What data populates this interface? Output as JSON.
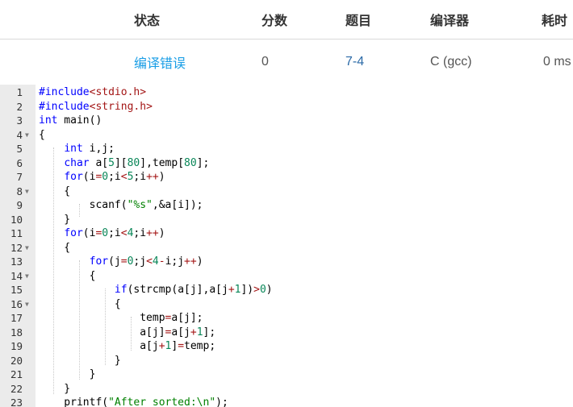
{
  "table": {
    "headers": [
      "状态",
      "分数",
      "题目",
      "编译器",
      "耗时"
    ],
    "row": {
      "status": "编译错误",
      "score": "0",
      "problem": "7-4",
      "compiler": "C (gcc)",
      "time": "0 ms"
    }
  },
  "editor": {
    "lines": [
      {
        "n": "1",
        "fold": false,
        "t": [
          [
            "#include",
            "kw"
          ],
          [
            "<stdio.h>",
            "inc"
          ]
        ]
      },
      {
        "n": "2",
        "fold": false,
        "t": [
          [
            "#include",
            "kw"
          ],
          [
            "<string.h>",
            "inc"
          ]
        ]
      },
      {
        "n": "3",
        "fold": false,
        "t": [
          [
            "int",
            "kw"
          ],
          [
            " main()",
            ""
          ]
        ]
      },
      {
        "n": "4",
        "fold": true,
        "t": [
          [
            "{",
            ""
          ]
        ]
      },
      {
        "n": "5",
        "fold": false,
        "t": [
          [
            "    ",
            ""
          ],
          [
            "int",
            "kw"
          ],
          [
            " i,j;",
            ""
          ]
        ]
      },
      {
        "n": "6",
        "fold": false,
        "t": [
          [
            "    ",
            ""
          ],
          [
            "char",
            "kw"
          ],
          [
            " a[",
            ""
          ],
          [
            "5",
            "num"
          ],
          [
            "][",
            ""
          ],
          [
            "80",
            "num"
          ],
          [
            "],temp[",
            ""
          ],
          [
            "80",
            "num"
          ],
          [
            "];",
            ""
          ]
        ]
      },
      {
        "n": "7",
        "fold": false,
        "t": [
          [
            "    ",
            ""
          ],
          [
            "for",
            "kw"
          ],
          [
            "(i",
            ""
          ],
          [
            "=",
            "op"
          ],
          [
            "0",
            "num"
          ],
          [
            ";i",
            ""
          ],
          [
            "<",
            "op"
          ],
          [
            "5",
            "num"
          ],
          [
            ";i",
            ""
          ],
          [
            "++",
            "op"
          ],
          [
            ")",
            ""
          ]
        ]
      },
      {
        "n": "8",
        "fold": true,
        "t": [
          [
            "    {",
            ""
          ]
        ]
      },
      {
        "n": "9",
        "fold": false,
        "t": [
          [
            "        scanf(",
            ""
          ],
          [
            "\"%s\"",
            "str"
          ],
          [
            ",&a[i]);",
            ""
          ]
        ]
      },
      {
        "n": "10",
        "fold": false,
        "t": [
          [
            "    }",
            ""
          ]
        ]
      },
      {
        "n": "11",
        "fold": false,
        "t": [
          [
            "    ",
            ""
          ],
          [
            "for",
            "kw"
          ],
          [
            "(i",
            ""
          ],
          [
            "=",
            "op"
          ],
          [
            "0",
            "num"
          ],
          [
            ";i",
            ""
          ],
          [
            "<",
            "op"
          ],
          [
            "4",
            "num"
          ],
          [
            ";i",
            ""
          ],
          [
            "++",
            "op"
          ],
          [
            ")",
            ""
          ]
        ]
      },
      {
        "n": "12",
        "fold": true,
        "t": [
          [
            "    {",
            ""
          ]
        ]
      },
      {
        "n": "13",
        "fold": false,
        "t": [
          [
            "        ",
            ""
          ],
          [
            "for",
            "kw"
          ],
          [
            "(j",
            ""
          ],
          [
            "=",
            "op"
          ],
          [
            "0",
            "num"
          ],
          [
            ";j",
            ""
          ],
          [
            "<",
            "op"
          ],
          [
            "4",
            "num"
          ],
          [
            "-",
            "op"
          ],
          [
            "i;j",
            ""
          ],
          [
            "++",
            "op"
          ],
          [
            ")",
            ""
          ]
        ]
      },
      {
        "n": "14",
        "fold": true,
        "t": [
          [
            "        {",
            ""
          ]
        ]
      },
      {
        "n": "15",
        "fold": false,
        "t": [
          [
            "            ",
            ""
          ],
          [
            "if",
            "kw"
          ],
          [
            "(strcmp(a[j],a[j",
            ""
          ],
          [
            "+",
            "op"
          ],
          [
            "1",
            "num"
          ],
          [
            "])",
            ""
          ],
          [
            ">",
            "op"
          ],
          [
            "0",
            "num"
          ],
          [
            ")",
            ""
          ]
        ]
      },
      {
        "n": "16",
        "fold": true,
        "t": [
          [
            "            {",
            ""
          ]
        ]
      },
      {
        "n": "17",
        "fold": false,
        "t": [
          [
            "                temp",
            ""
          ],
          [
            "=",
            "op"
          ],
          [
            "a[j];",
            ""
          ]
        ]
      },
      {
        "n": "18",
        "fold": false,
        "t": [
          [
            "                a[j]",
            ""
          ],
          [
            "=",
            "op"
          ],
          [
            "a[j",
            ""
          ],
          [
            "+",
            "op"
          ],
          [
            "1",
            "num"
          ],
          [
            "];",
            ""
          ]
        ]
      },
      {
        "n": "19",
        "fold": false,
        "t": [
          [
            "                a[j",
            ""
          ],
          [
            "+",
            "op"
          ],
          [
            "1",
            "num"
          ],
          [
            "]",
            ""
          ],
          [
            "=",
            "op"
          ],
          [
            "temp;",
            ""
          ]
        ]
      },
      {
        "n": "20",
        "fold": false,
        "t": [
          [
            "            }",
            ""
          ]
        ]
      },
      {
        "n": "21",
        "fold": false,
        "t": [
          [
            "        }",
            ""
          ]
        ]
      },
      {
        "n": "22",
        "fold": false,
        "t": [
          [
            "    }",
            ""
          ]
        ]
      },
      {
        "n": "23",
        "fold": false,
        "t": [
          [
            "    printf(",
            ""
          ],
          [
            "\"After sorted:\\n\"",
            "str"
          ],
          [
            ");",
            ""
          ]
        ]
      }
    ],
    "colors": {
      "kw": "#0000ff",
      "inc": "#a31515",
      "str": "#008000",
      "num": "#098658",
      "op": "#a31515",
      "": "#000000"
    }
  }
}
